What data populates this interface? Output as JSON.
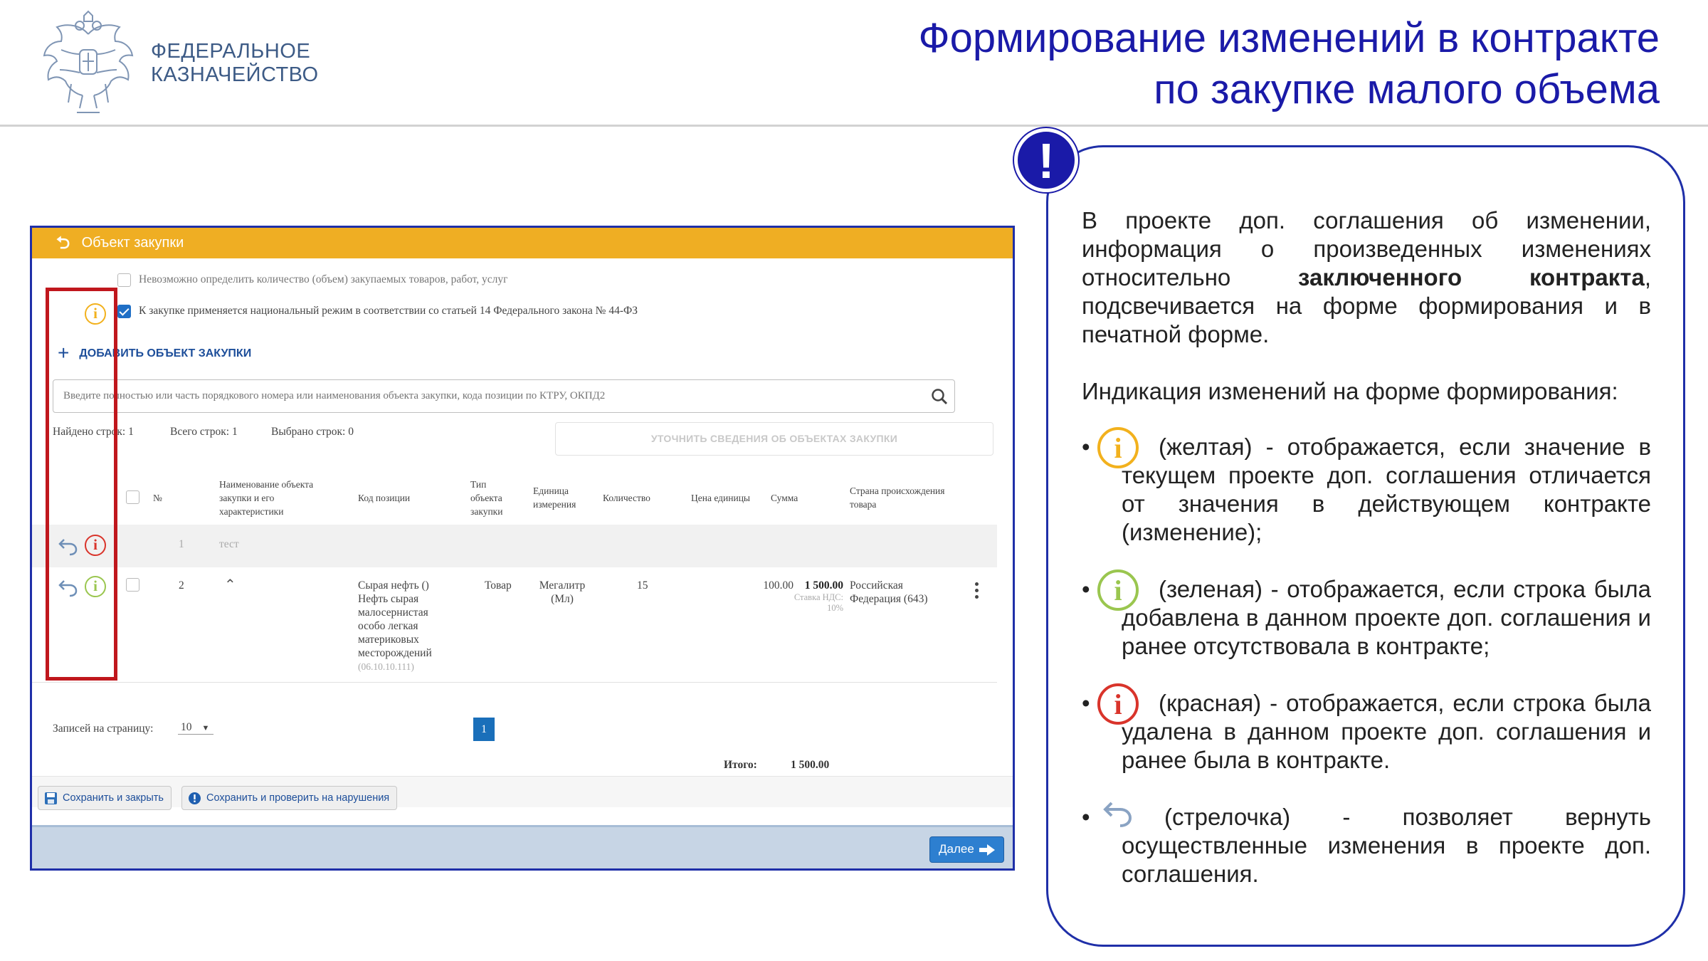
{
  "header": {
    "logo_lines": [
      "ФЕДЕРАЛЬНОЕ",
      "КАЗНАЧЕЙСТВО"
    ],
    "title_lines": [
      "Формирование изменений в контракте",
      "по закупке малого объема"
    ]
  },
  "app": {
    "window_title": "Объект закупки",
    "checkbox_quantity_label": "Невозможно определить количество (объем) закупаемых товаров, работ, услуг",
    "checkbox_quantity_checked": false,
    "checkbox_national_label": "К закупке применяется национальный режим в соответствии со статьей 14 Федерального закона № 44-ФЗ",
    "checkbox_national_checked": true,
    "add_object_label": "ДОБАВИТЬ ОБЪЕКТ ЗАКУПКИ",
    "search_placeholder": "Введите полностью или часть порядкового номера или наименования объекта закупки, кода позиции по КТРУ, ОКПД2",
    "stats": {
      "found": "Найдено строк: 1",
      "total": "Всего строк: 1",
      "selected": "Выбрано строк: 0"
    },
    "refine_button": "УТОЧНИТЬ СВЕДЕНИЯ ОБ ОБЪЕКТАХ ЗАКУПКИ",
    "columns": {
      "num": "№",
      "name": "Наименование объекта закупки и его характеристики",
      "code": "Код позиции",
      "type": "Тип объекта закупки",
      "unit": "Единица измерения",
      "qty": "Количество",
      "price": "Цена единицы",
      "sum": "Сумма",
      "country": "Страна происхождения товара"
    },
    "rows": [
      {
        "num": "1",
        "name": "тест"
      },
      {
        "num": "2",
        "code_lines": [
          "Сырая нефть ()",
          "Нефть сырая",
          "малосернистая",
          "особо легкая",
          "материковых",
          "месторождений"
        ],
        "code_ref": "(06.10.10.111)",
        "type": "Товар",
        "unit": "Мегалитр",
        "unit_abbr": "(Мл)",
        "qty": "15",
        "price": "100.00",
        "sum": "1 500.00",
        "vat_lines": [
          "Ставка НДС:",
          "10%"
        ],
        "country_lines": [
          "Российская",
          "Федерация (643)"
        ]
      }
    ],
    "page_size_label": "Записей на страницу:",
    "page_size_value": "10",
    "current_page": "1",
    "total_label": "Итого:",
    "total_value": "1 500.00",
    "save_close_label": "Сохранить и закрыть",
    "save_check_label": "Сохранить и проверить на нарушения",
    "next_label": "Далее"
  },
  "callout": {
    "intro_start": "В проекте доп. соглашения об изменении, информация о произведенных изменениях относительно ",
    "intro_bold": "заключенного контракта",
    "intro_end": ", подсвечивается на форме формирования и в печатной форме.",
    "indication_heading": "Индикация изменений на форме формирования:",
    "bullets": [
      {
        "icon": "info-yellow-icon",
        "text": "(желтая) - отображается, если значение в текущем проекте доп. соглашения отличается от значения в действующем контракте (изменение);"
      },
      {
        "icon": "info-green-icon",
        "text": "(зеленая) - отображается, если строка была добавлена в данном проекте доп. соглашения и ранее отсутствовала в контракте;"
      },
      {
        "icon": "info-red-icon",
        "text": "(красная) -  отображается, если строка была удалена в данном проекте доп. соглашения и ранее была в контракте."
      },
      {
        "icon": "revert-arrow-icon",
        "text": "(стрелочка)  -     позволяет вернуть осуществленные изменения в проекте доп. соглашения."
      }
    ]
  },
  "colors": {
    "title_blue": "#1a1aa8",
    "frame_blue": "#1f2fa8",
    "titlebar_orange": "#efae23",
    "highlight_red": "#c0171d",
    "info_yellow": "#f2b11d",
    "info_green": "#9ac64f",
    "info_red": "#d9342b"
  }
}
